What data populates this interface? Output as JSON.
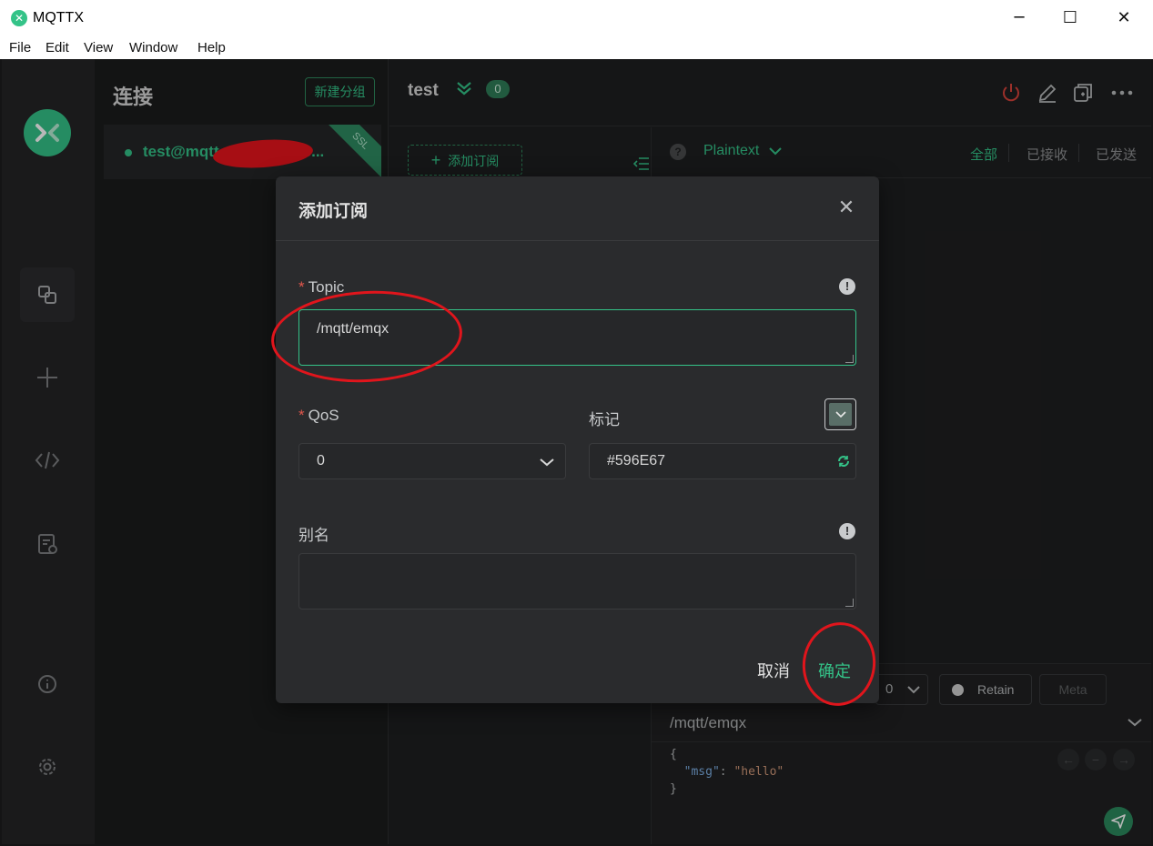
{
  "window": {
    "title": "MQTTX",
    "minimize_glyph": "─",
    "maximize_glyph": "☐",
    "close_glyph": "✕"
  },
  "menu": [
    "File",
    "Edit",
    "View",
    "Window",
    "Help"
  ],
  "connections_panel": {
    "title": "连接",
    "new_group_label": "新建分组",
    "connection": {
      "name": "test@mqtt",
      "name_tail": "c...",
      "badge": "SSL",
      "status": "connected"
    }
  },
  "main": {
    "connection_title": "test",
    "subscription_count": "0",
    "add_subscription_label": "添加订阅",
    "payload_format": "Plaintext",
    "filters": {
      "all": "全部",
      "received": "已接收",
      "sent": "已发送"
    },
    "composer": {
      "qos": "0",
      "retain_label": "Retain",
      "meta_label": "Meta",
      "topic": "/mqtt/emqx",
      "payload_key": "\"msg\"",
      "payload_value": "\"hello\""
    }
  },
  "dialog": {
    "title": "添加订阅",
    "topic_label": "Topic",
    "topic_value": "/mqtt/emqx",
    "qos_label": "QoS",
    "qos_value": "0",
    "color_label": "标记",
    "color_value": "#596E67",
    "alias_label": "别名",
    "alias_value": "",
    "cancel_label": "取消",
    "confirm_label": "确定"
  },
  "colors": {
    "accent": "#34c388",
    "tag_color": "#596E67",
    "annotation": "#e0151c"
  },
  "icons": {
    "app_logo": "mqttx-logo-icon",
    "nav": [
      "connections-icon",
      "plus-icon",
      "code-icon",
      "log-icon",
      "info-icon",
      "gear-icon"
    ],
    "header": [
      "power-icon",
      "edit-icon",
      "new-window-icon",
      "more-icon"
    ]
  }
}
